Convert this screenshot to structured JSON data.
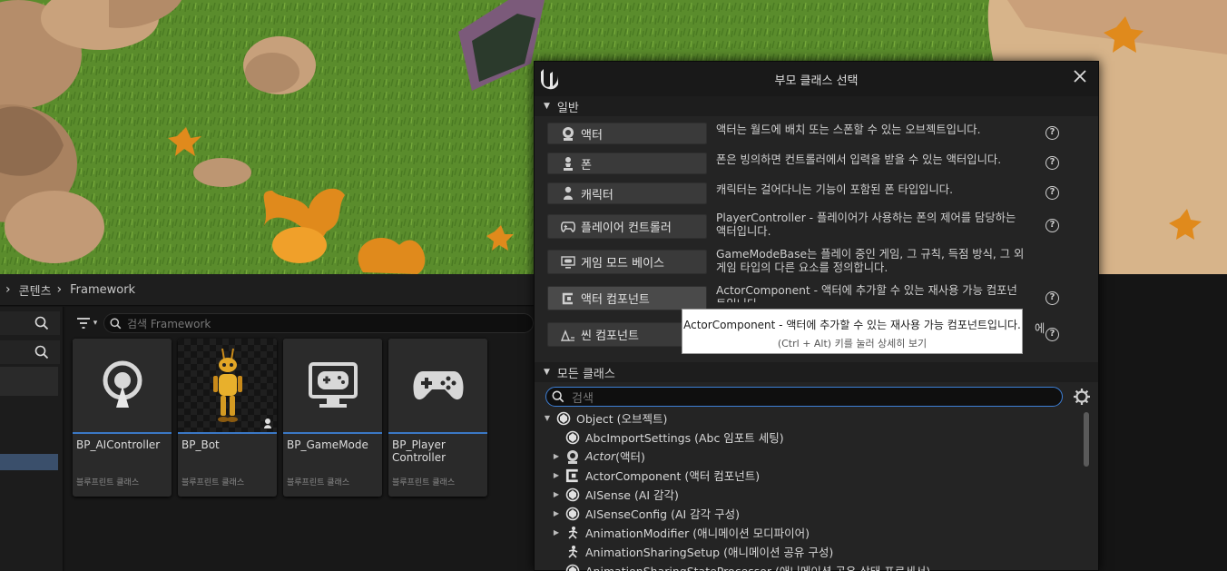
{
  "breadcrumb": {
    "items": [
      "콘텐츠",
      "Framework"
    ]
  },
  "content_browser": {
    "search_placeholder": "검색 Framework",
    "assets": [
      {
        "name": "BP_AIController",
        "type": "블루프린트 클래스",
        "icon": "ai-controller-icon"
      },
      {
        "name": "BP_Bot",
        "type": "블루프린트 클래스",
        "icon": "robot-icon"
      },
      {
        "name": "BP_GameMode",
        "type": "블루프린트 클래스",
        "icon": "game-mode-icon"
      },
      {
        "name": "BP_Player Controller",
        "type": "블루프린트 클래스",
        "icon": "gamepad-icon"
      }
    ]
  },
  "dialog": {
    "title": "부모 클래스 선택",
    "common_section": "일반",
    "common_classes": [
      {
        "label": "액터",
        "icon": "actor-icon",
        "desc": "액터는 월드에 배치 또는 스폰할 수 있는 오브젝트입니다."
      },
      {
        "label": "폰",
        "icon": "pawn-icon",
        "desc": "폰은 빙의하면 컨트롤러에서 입력을 받을 수 있는 액터입니다."
      },
      {
        "label": "캐릭터",
        "icon": "character-icon",
        "desc": "캐릭터는 걸어다니는 기능이 포함된 폰 타입입니다."
      },
      {
        "label": "플레이어 컨트롤러",
        "icon": "gamepad-icon",
        "desc": "PlayerController - 플레이어가 사용하는 폰의 제어를 담당하는 액터입니다."
      },
      {
        "label": "게임 모드 베이스",
        "icon": "game-mode-icon",
        "desc": "GameModeBase는 플레이 중인 게임, 그 규칙, 득점 방식, 그 외 게임 타입의 다른 요소를 정의합니다."
      },
      {
        "label": "액터 컴포넌트",
        "icon": "component-icon",
        "desc": "ActorComponent - 액터에 추가할 수 있는 재사용 가능 컴포넌트입니다."
      },
      {
        "label": "씬 컴포넌트",
        "icon": "scene-component-icon",
        "desc": "에"
      }
    ],
    "tooltip": {
      "text": "ActorComponent - 액터에 추가할 수 있는 재사용 가능 컴포넌트입니다.",
      "hint": "(Ctrl + Alt) 키를 눌러 상세히 보기"
    },
    "all_section": "모든 클래스",
    "search_placeholder": "검색",
    "tree": [
      {
        "label": "Object (오브젝트)",
        "italic_part": "",
        "expanded": true,
        "level": 0,
        "icon": "object-icon"
      },
      {
        "label": "AbcImportSettings (Abc 임포트 세팅)",
        "italic_part": "",
        "expandable": false,
        "level": 1,
        "icon": "object-icon"
      },
      {
        "label": " (액터)",
        "italic_part": "Actor",
        "expandable": true,
        "level": 1,
        "icon": "actor-icon"
      },
      {
        "label": "ActorComponent (액터 컴포넌트)",
        "italic_part": "",
        "expandable": true,
        "level": 1,
        "icon": "component-icon"
      },
      {
        "label": "AISense (AI 감각)",
        "italic_part": "",
        "expandable": true,
        "level": 1,
        "icon": "object-icon"
      },
      {
        "label": "AISenseConfig (AI 감각 구성)",
        "italic_part": "",
        "expandable": true,
        "level": 1,
        "icon": "object-icon"
      },
      {
        "label": "AnimationModifier (애니메이션 모디파이어)",
        "italic_part": "",
        "expandable": true,
        "level": 1,
        "icon": "animation-icon"
      },
      {
        "label": "AnimationSharingSetup (애니메이션 공유 구성)",
        "italic_part": "",
        "expandable": false,
        "level": 1,
        "icon": "animation-icon"
      },
      {
        "label": "AnimationSharingStateProcessor (애니메이션 공유 상태 프로세서)",
        "italic_part": "",
        "expandable": false,
        "level": 1,
        "icon": "object-icon"
      }
    ]
  },
  "colors": {
    "accent": "#3d7fd6",
    "panel": "#242424",
    "grass": "#5c8f2e"
  }
}
